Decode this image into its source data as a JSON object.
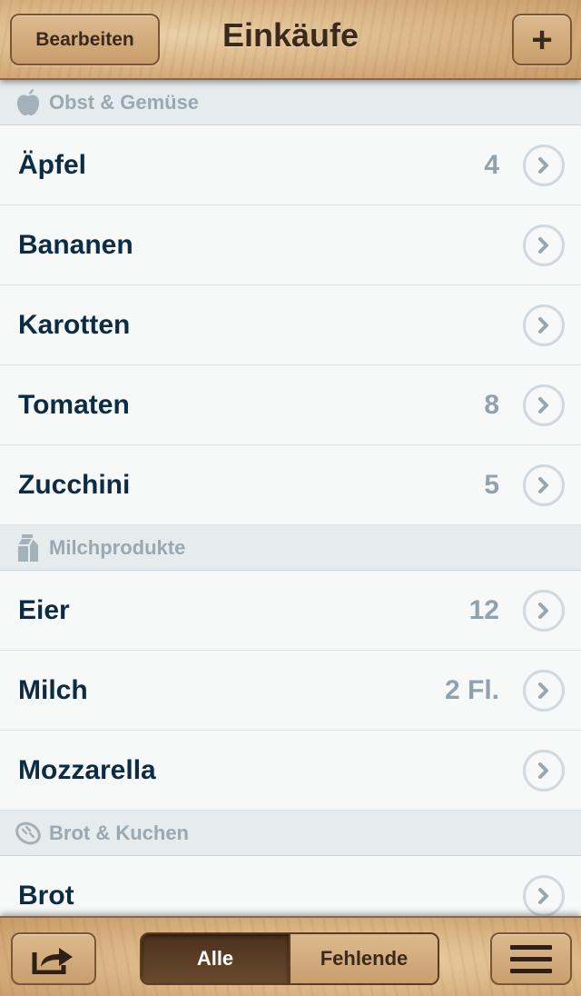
{
  "navbar": {
    "title": "Einkäufe",
    "edit_label": "Bearbeiten",
    "add_label": "+"
  },
  "sections": [
    {
      "label": "Obst & Gemüse",
      "icon": "apple-icon",
      "items": [
        {
          "name": "Äpfel",
          "qty": "4"
        },
        {
          "name": "Bananen",
          "qty": ""
        },
        {
          "name": "Karotten",
          "qty": ""
        },
        {
          "name": "Tomaten",
          "qty": "8"
        },
        {
          "name": "Zucchini",
          "qty": "5"
        }
      ]
    },
    {
      "label": "Milchprodukte",
      "icon": "milk-carton-icon",
      "items": [
        {
          "name": "Eier",
          "qty": "12"
        },
        {
          "name": "Milch",
          "qty": "2 Fl."
        },
        {
          "name": "Mozzarella",
          "qty": ""
        }
      ]
    },
    {
      "label": "Brot & Kuchen",
      "icon": "bread-icon",
      "items": [
        {
          "name": "Brot",
          "qty": ""
        }
      ]
    }
  ],
  "toolbar": {
    "share_icon": "share-icon",
    "segments": {
      "all": "Alle",
      "missing": "Fehlende"
    },
    "selected_segment": "Alle",
    "menu_icon": "menu-icon"
  },
  "colors": {
    "item_text": "#0c2c44",
    "quantity_text": "#8fa2ae",
    "section_text": "#9aa8b1",
    "wood": "#dcb888"
  }
}
